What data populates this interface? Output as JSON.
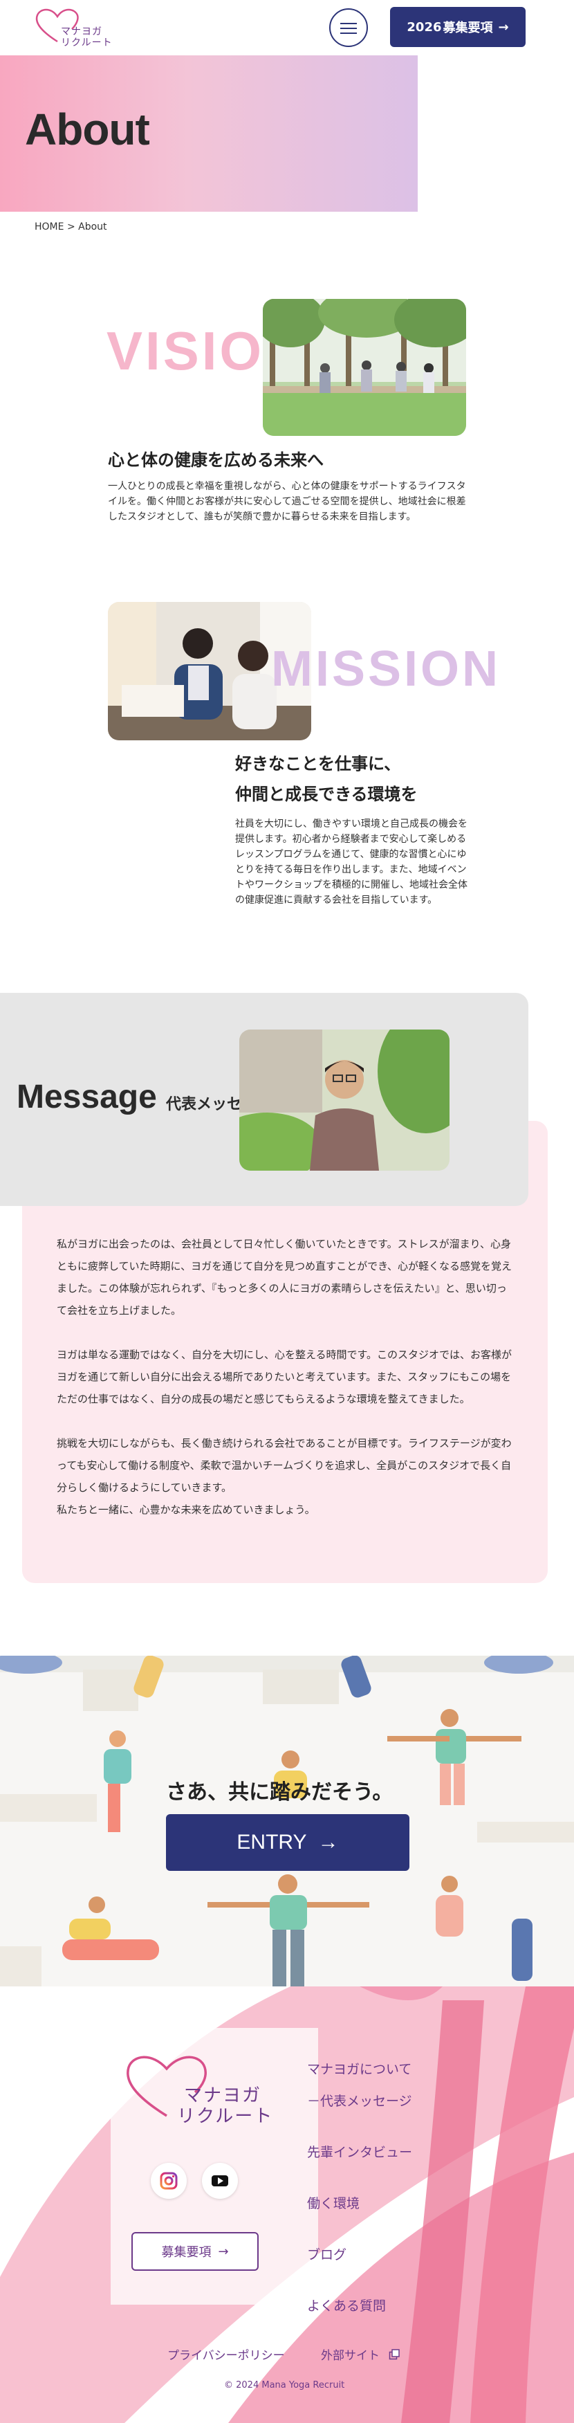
{
  "header": {
    "logo_line1": "マナヨガ",
    "logo_line2": "リクルート",
    "recruit_label": "2026",
    "recruit_label2": "募集要項",
    "arrow": "→"
  },
  "hero": {
    "title": "About"
  },
  "breadcrumb": {
    "home": "HOME",
    "separator": ">",
    "current": "About"
  },
  "vision": {
    "word": "VISION",
    "heading": "心と体の健康を広める未来へ",
    "text": "一人ひとりの成長と幸福を重視しながら、心と体の健康をサポートするライフスタイルを。働く仲間とお客様が共に安心して過ごせる空間を提供し、地域社会に根差したスタジオとして、誰もが笑顔で豊かに暮らせる未来を目指します。"
  },
  "mission": {
    "word": "MISSION",
    "heading_line1": "好きなことを仕事に、",
    "heading_line2": "仲間と成長できる環境を",
    "text": "社員を大切にし、働きやすい環境と自己成長の機会を提供します。初心者から経験者まで安心して楽しめるレッスンプログラムを通じて、健康的な習慣と心にゆとりを持てる毎日を作り出します。また、地域イベントやワークショップを積極的に開催し、地域社会全体の健康促進に貢献する会社を目指しています。"
  },
  "message": {
    "title": "Message",
    "subtitle": "代表メッセージ",
    "paragraphs": [
      "私がヨガに出会ったのは、会社員として日々忙しく働いていたときです。ストレスが溜まり、心身ともに疲弊していた時期に、ヨガを通じて自分を見つめ直すことができ、心が軽くなる感覚を覚えました。この体験が忘れられず、『もっと多くの人にヨガの素晴らしさを伝えたい』と、思い切って会社を立ち上げました。",
      "ヨガは単なる運動ではなく、自分を大切にし、心を整える時間です。このスタジオでは、お客様がヨガを通じて新しい自分に出会える場所でありたいと考えています。また、スタッフにもこの場をただの仕事ではなく、自分の成長の場だと感じてもらえるような環境を整えてきました。",
      "挑戦を大切にしながらも、長く働き続けられる会社であることが目標です。ライフステージが変わっても安心して働ける制度や、柔軟で温かいチームづくりを追求し、全員がこのスタジオで長く自分らしく働けるようにしていきます。\n私たちと一緒に、心豊かな未来を広めていきましょう。"
    ]
  },
  "entry": {
    "heading": "さあ、共に踏みだそう。",
    "button_label": "ENTRY",
    "arrow": "→"
  },
  "footer": {
    "logo_line1": "マナヨガ",
    "logo_line2": "リクルート",
    "nav": [
      "マナヨガについて",
      "－代表メッセージ",
      "先輩インタビュー",
      "働く環境",
      "ブログ",
      "よくある質問"
    ],
    "recruit_label": "募集要項",
    "arrow": "→",
    "privacy": "プライバシーポリシー",
    "external": "外部サイト",
    "copyright": "© 2024 Mana Yoga Recruit"
  },
  "colors": {
    "navy": "#2c3478",
    "purple": "#6c3a8a",
    "pink": "#f6b6cb",
    "lavender": "#dcc0e6"
  }
}
